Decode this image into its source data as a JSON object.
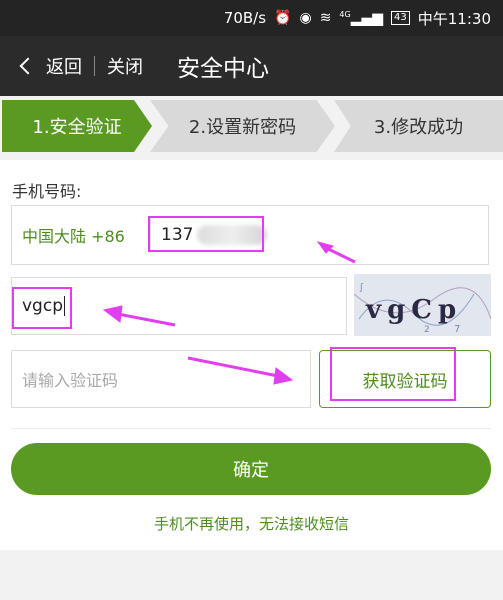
{
  "status_bar": {
    "speed": "70B/s",
    "icons": [
      "alarm-icon",
      "eye-icon",
      "wifi-icon",
      "signal-icon"
    ],
    "network": "4G",
    "battery": "43",
    "time": "中午11:30"
  },
  "title_bar": {
    "back_label": "返回",
    "close_label": "关闭",
    "title": "安全中心"
  },
  "steps": [
    {
      "label": "1.安全验证",
      "active": true
    },
    {
      "label": "2.设置新密码",
      "active": false
    },
    {
      "label": "3.修改成功",
      "active": false
    }
  ],
  "form": {
    "phone_label": "手机号码:",
    "country_code": "中国大陆 +86",
    "phone_value": "137",
    "captcha_value": "vgcp",
    "captcha_image_text": "vgCp",
    "code_placeholder": "请输入验证码",
    "get_code_label": "获取验证码",
    "confirm_label": "确定",
    "no_phone_link": "手机不再使用，无法接收短信"
  },
  "colors": {
    "accent": "#5a9a22",
    "accent_text": "#4e8c1f",
    "annotation": "#e33df0"
  }
}
